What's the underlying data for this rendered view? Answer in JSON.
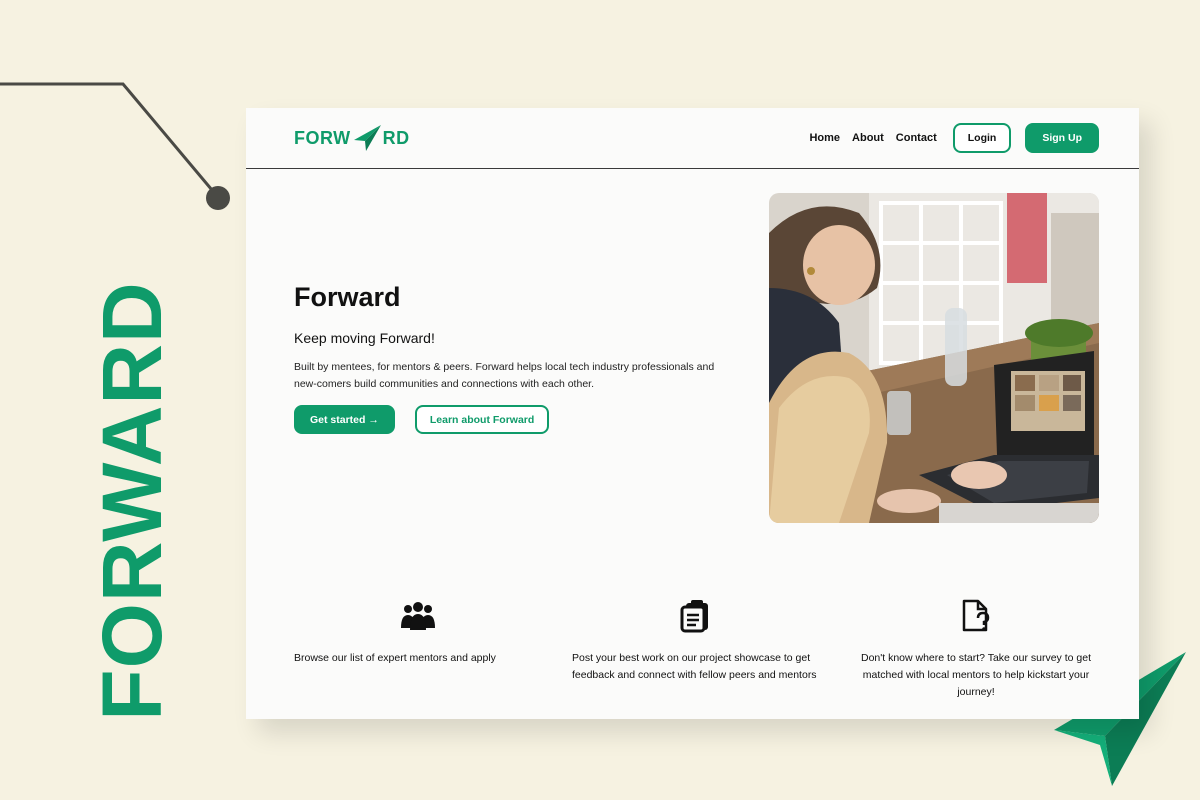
{
  "brand": {
    "vertical_text": "FORWARD",
    "logo_left": "FORW",
    "logo_right": "RD",
    "accent": "#0f9b6a"
  },
  "nav": {
    "links": [
      "Home",
      "About",
      "Contact"
    ],
    "login": "Login",
    "signup": "Sign Up"
  },
  "hero": {
    "title": "Forward",
    "tagline": "Keep moving Forward!",
    "description": "Built by mentees, for mentors & peers. Forward helps local tech industry professionals and new-comers build communities and connections with each other.",
    "cta_primary": "Get started →",
    "cta_secondary": "Learn about Forward"
  },
  "features": [
    {
      "icon": "group-icon",
      "text": "Browse our list of expert mentors and apply"
    },
    {
      "icon": "clipboard-icon",
      "text": "Post your best work on our project showcase to get feedback and connect with fellow peers and mentors"
    },
    {
      "icon": "question-document-icon",
      "text": "Don't know where to start? Take our survey to get matched with local mentors to help kickstart your journey!"
    }
  ]
}
